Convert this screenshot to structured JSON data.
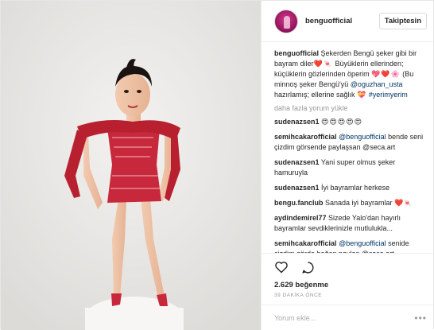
{
  "header": {
    "username": "benguofficial",
    "follow_label": "Takiptesin"
  },
  "caption": {
    "username": "benguofficial",
    "text_1": "Şekerden Bengü şeker gibi bir bayram diler",
    "emoji_1": "❤️🍬",
    "text_2": "Büyüklerin ellerinden; küçüklerin gözlerinden öperim",
    "emoji_2": "💖❤️🌸",
    "text_3": "(Bu minnoş şeker Bengü'yü",
    "mention": "@oguzhan_usta",
    "text_4": "hazırlamış; ellerine sağlık",
    "emoji_3": "💝",
    "hashtag": "#yerimyerim"
  },
  "load_more": "daha fazla yorum yükle",
  "comments": [
    {
      "user": "sudenazsen1",
      "text": "😍😍😍😍😍",
      "mention": ""
    },
    {
      "user": "semihcakarofficial",
      "mention": "@benguofficial",
      "text": "bende seni çizdim görsende paylaşsan @seca.art"
    },
    {
      "user": "sudenazsen1",
      "mention": "",
      "text": "Yani super olmus şeker hamuruyla"
    },
    {
      "user": "sudenazsen1",
      "mention": "",
      "text": "İyi bayramlar herkese"
    },
    {
      "user": "bengu.fanclub",
      "mention": "",
      "text": "Sanada iyi bayramlar ❤️🍬"
    },
    {
      "user": "aydindemirel77",
      "mention": "",
      "text": "Sizede Yalo'dan hayırlı bayramlar sevdiklerinizle mutlulukla..."
    },
    {
      "user": "semihcakarofficial",
      "mention": "@benguofficial",
      "text": "senide çizdim görde beğen paylaş @seca.art"
    }
  ],
  "likes": "2.629 beğenme",
  "time_ago": "39 DAKİKA ÖNCE",
  "comment_placeholder": "Yorum ekle...",
  "more_options": "•••",
  "colors": {
    "dress": "#c8283c",
    "background": "#ebeae8",
    "link": "#003569"
  }
}
